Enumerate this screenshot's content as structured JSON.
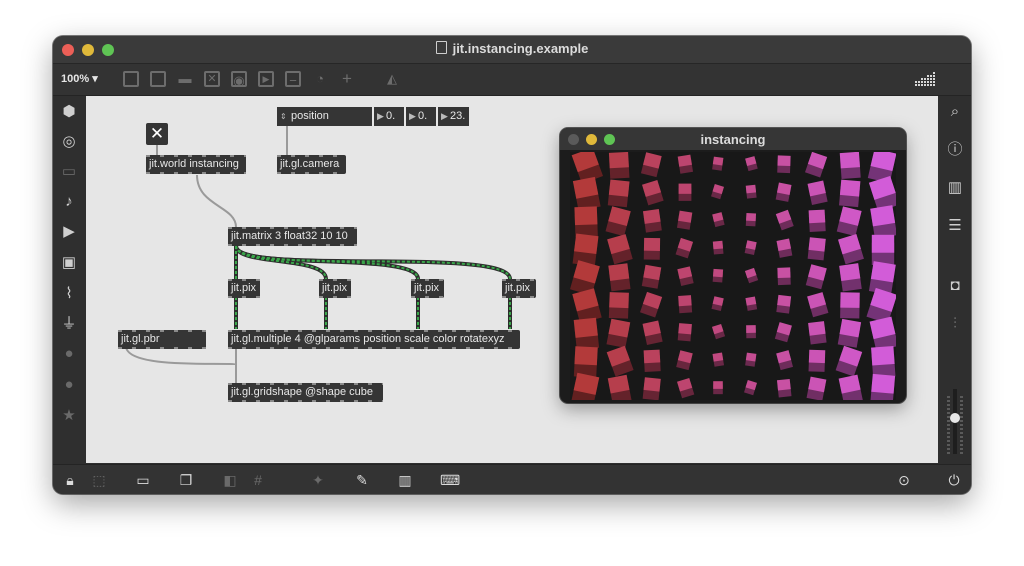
{
  "window": {
    "title": "jit.instancing.example"
  },
  "toolbar": {
    "zoom": "100% ▾"
  },
  "patch": {
    "toggle_symbol": "✕",
    "objects": {
      "world": "jit.world instancing",
      "camera": "jit.gl.camera",
      "matrix": "jit.matrix 3 float32 10 10",
      "pix1": "jit.pix",
      "pix2": "jit.pix",
      "pix3": "jit.pix",
      "pix4": "jit.pix",
      "pbr": "jit.gl.pbr",
      "multiple": "jit.gl.multiple 4 @glparams position scale color rotatexyz",
      "gridshape": "jit.gl.gridshape @shape cube"
    },
    "message": {
      "label": "position",
      "values": [
        "0.",
        "0.",
        "23."
      ]
    }
  },
  "render_window": {
    "title": "instancing"
  },
  "colors": {
    "render_left": "#b33a3a",
    "render_right": "#d25cd8",
    "patch_cord_green": "#3aa64a"
  },
  "icons": {
    "left": [
      "package-icon",
      "target-icon",
      "media-icon",
      "music-note-icon",
      "video-icon",
      "image-icon",
      "paperclip-icon",
      "plug-icon",
      "beap-icon",
      "bach-icon",
      "star-icon"
    ],
    "right": [
      "search-icon",
      "info-icon",
      "book-icon",
      "list-icon",
      "snapshot-icon",
      "mixer-icon"
    ],
    "bottom": [
      "lock-icon",
      "present-icon",
      "presentation-icon",
      "window-icon",
      "mute-icon",
      "grid-icon",
      "debug-icon",
      "wrench-icon",
      "piano-icon",
      "keyboard-icon",
      "play-icon",
      "power-icon"
    ]
  }
}
